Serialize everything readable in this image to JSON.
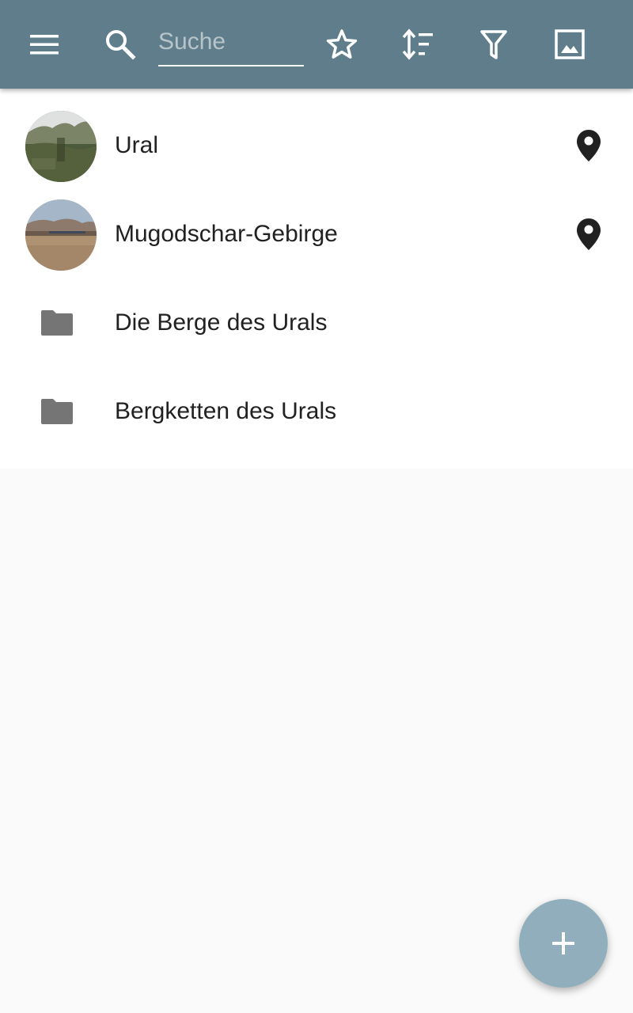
{
  "toolbar": {
    "menu_icon": "menu-icon",
    "search_icon": "search-icon",
    "search_placeholder": "Suche",
    "search_value": "",
    "actions": [
      {
        "icon": "star-outline-icon"
      },
      {
        "icon": "sort-icon"
      },
      {
        "icon": "filter-icon"
      },
      {
        "icon": "image-icon"
      }
    ],
    "background": "#607d8b"
  },
  "list": {
    "items": [
      {
        "label": "Ural",
        "kind": "place",
        "thumbnail": "snowy-mountain-photo",
        "trailing_icon": "location-pin-icon"
      },
      {
        "label": "Mugodschar-Gebirge",
        "kind": "place",
        "thumbnail": "steppe-hills-photo",
        "trailing_icon": "location-pin-icon"
      },
      {
        "label": "Die Berge des Urals",
        "kind": "folder",
        "leading_icon": "folder-icon"
      },
      {
        "label": "Bergketten des Urals",
        "kind": "folder",
        "leading_icon": "folder-icon"
      }
    ]
  },
  "fab": {
    "icon": "plus-icon",
    "color": "#90aebb"
  }
}
